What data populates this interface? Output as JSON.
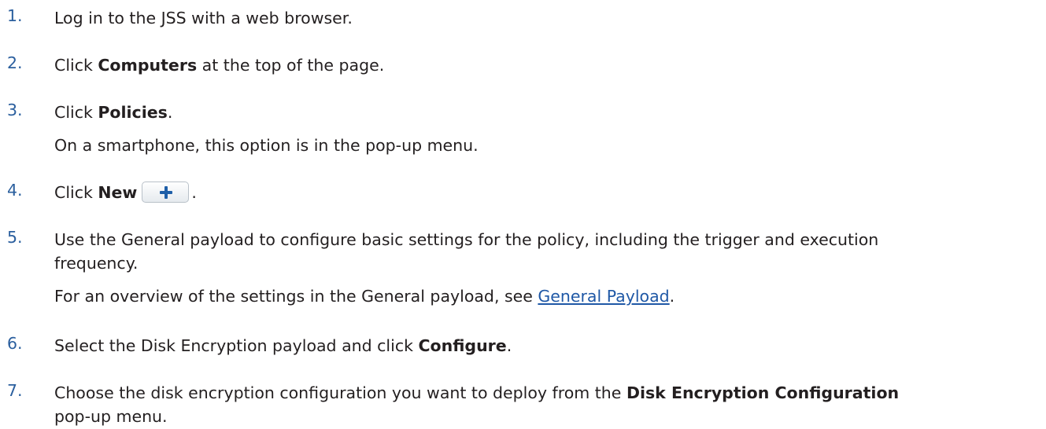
{
  "steps": [
    {
      "num": "1.",
      "text": "Log in to the JSS with a web browser."
    },
    {
      "num": "2.",
      "pre": "Click ",
      "bold": "Computers",
      "post": " at the top of the page."
    },
    {
      "num": "3.",
      "pre": "Click ",
      "bold": "Policies",
      "post": ".",
      "note": "On a smartphone, this option is in the pop-up menu."
    },
    {
      "num": "4.",
      "pre": "Click ",
      "bold": "New",
      "post": ".",
      "icon": "plus-icon"
    },
    {
      "num": "5.",
      "line1": "Use the General payload to configure basic settings for the policy, including the trigger and execution",
      "line2": "frequency.",
      "note_pre": "For an overview of the settings in the General payload, see ",
      "link": "General Payload",
      "note_post": "."
    },
    {
      "num": "6.",
      "pre": "Select the Disk Encryption payload and click ",
      "bold": "Configure",
      "post": "."
    },
    {
      "num": "7.",
      "pre": "Choose the disk encryption configuration you want to deploy from the ",
      "bold": "Disk Encryption Configuration",
      "line2": "pop-up menu."
    }
  ],
  "colors": {
    "number": "#2b5f9e",
    "link": "#1f58a6",
    "text": "#231f20"
  }
}
